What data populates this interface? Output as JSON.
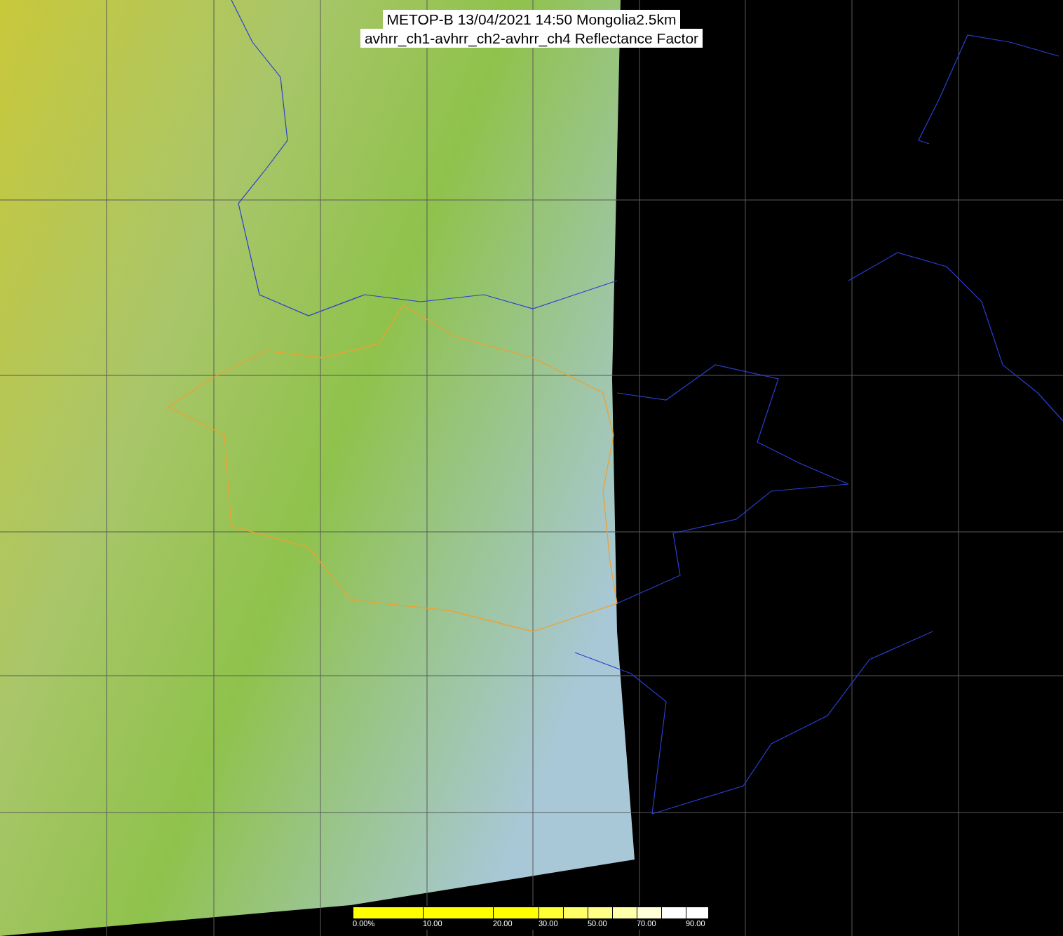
{
  "title": {
    "lines": [
      "METOP-B 13/04/2021 14:50 Mongolia2.5km",
      "avhrr_ch1-avhrr_ch2-avhrr_ch4 Reflectance Factor"
    ]
  },
  "colorbar": {
    "segments": [
      {
        "color": "#ffff00",
        "label": "0.00%"
      },
      {
        "color": "#ffff00",
        "label": "10.00"
      },
      {
        "color": "#ffff00",
        "label": "20.00"
      },
      {
        "color": "#ffff33",
        "label": "30.00"
      },
      {
        "color": "#ffff66"
      },
      {
        "color": "#ffff88",
        "label": "50.00"
      },
      {
        "color": "#ffffaa"
      },
      {
        "color": "#ffffd8",
        "label": "70.00"
      },
      {
        "color": "#ffffff"
      },
      {
        "color": "#ffffff",
        "label": "90.00"
      }
    ]
  }
}
